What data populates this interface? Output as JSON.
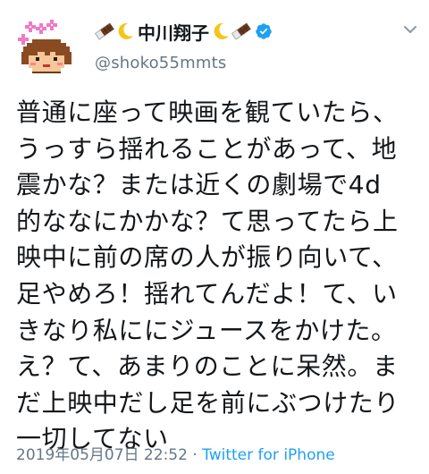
{
  "user": {
    "display_name": "中川翔子",
    "handle": "@shoko55mmts",
    "name_emojis": [
      "chocolate-emoji",
      "crescent-moon-emoji"
    ],
    "verified": true,
    "avatar": "pixel-art-face-avatar"
  },
  "tweet": {
    "text": "普通に座って映画を観ていたら、\nうっすら揺れることがあって、地\n震かな？または近くの劇場で4d\n的ななにかかな？て思ってたら上\n映中に前の席の人が振り向いて、\n足やめろ！揺れてんだよ！て、い\nきなり私ににジュースをかけた。\nえ？て、あまりのことに呆然。ま\nだ上映中だし足を前にぶつけたり\n一切してない"
  },
  "meta": {
    "timestamp": "2019年05月07日 22:52",
    "separator": " · ",
    "source": "Twitter for iPhone"
  },
  "icons": {
    "menu": "chevron-down-icon",
    "verified": "verified-badge-icon"
  },
  "colors": {
    "text": "#14171a",
    "secondary": "#657786",
    "link": "#1da1f2",
    "verified": "#1da1f2"
  }
}
